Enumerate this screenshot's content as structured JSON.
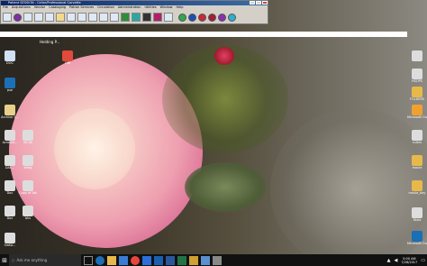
{
  "app_window": {
    "title": "Patient SESSION - Cellar/Professional Corvette",
    "menu": [
      "File",
      "Acquisitions",
      "Vendor",
      "Cataloging",
      "Patron Services",
      "Circulation",
      "Administration",
      "Utilities",
      "Window",
      "Help"
    ]
  },
  "desktop": {
    "top_label": "Holding P...",
    "left_icons": [
      {
        "label": "DOC",
        "color": "#cfe0f7"
      },
      {
        "label": "pse",
        "color": "#1c6fb5"
      },
      {
        "label": "Archive S...",
        "color": "#e7d08a"
      },
      {
        "label": "Acrobat...",
        "color": "#dddddd"
      },
      {
        "label": "DAL...",
        "color": "#dddddd"
      },
      {
        "label": "Doc",
        "color": "#dddddd"
      },
      {
        "label": "Doc",
        "color": "#dddddd"
      },
      {
        "label": "OaKA...",
        "color": "#dddddd"
      }
    ],
    "mid_icons": [
      {
        "label": "File",
        "color": "#e24a3b"
      },
      {
        "label": "All bk",
        "color": "#dddddd"
      },
      {
        "label": "sfreg",
        "color": "#dddddd"
      },
      {
        "label": "Copy of lbk",
        "color": "#dddddd"
      },
      {
        "label": "bks",
        "color": "#dddddd"
      }
    ],
    "right_icons": [
      {
        "label": "",
        "color": "#dddddd"
      },
      {
        "label": "HSOPS",
        "color": "#dddddd"
      },
      {
        "label": "FOLDERS",
        "color": "#e7b94a"
      },
      {
        "label": "Microsoft Outlook 2016",
        "color": "#f0a030"
      },
      {
        "label": "rulers",
        "color": "#dddddd"
      },
      {
        "label": "movie",
        "color": "#e7b94a"
      },
      {
        "label": "movie_day",
        "color": "#e7b94a"
      },
      {
        "label": "Dials",
        "color": "#dddddd"
      },
      {
        "label": "Microsoft Outlook 2016",
        "color": "#1a6fb5"
      }
    ]
  },
  "taskbar": {
    "search_placeholder": "Ask me anything",
    "time": "5:00 AM",
    "date": "7/26/2017"
  }
}
